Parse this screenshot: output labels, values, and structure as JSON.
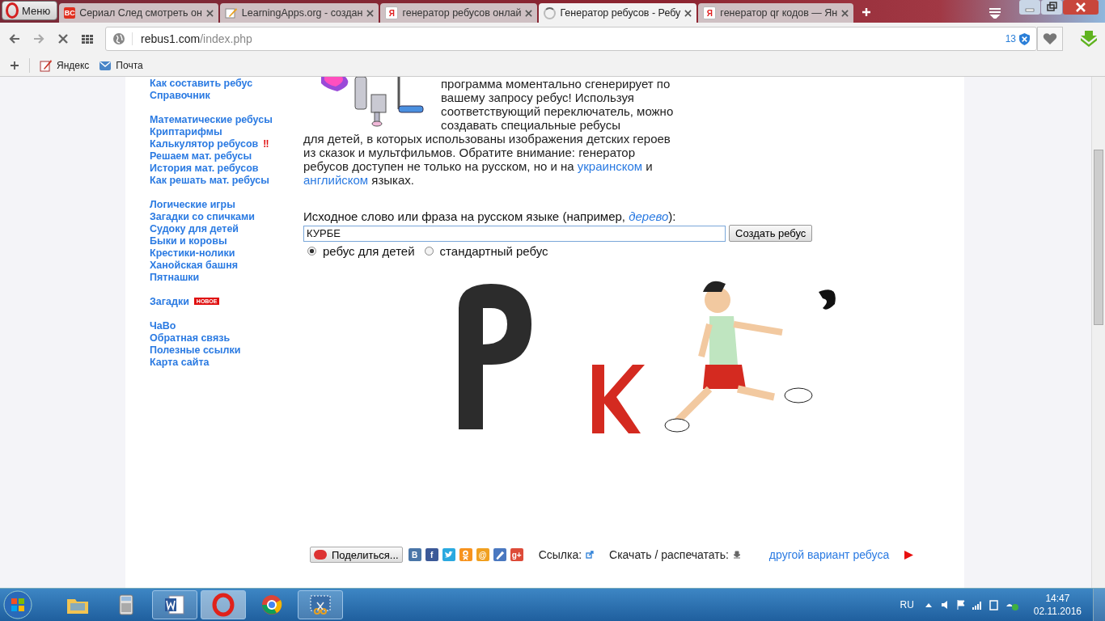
{
  "browser": {
    "menu_label": "Меню",
    "tabs": [
      {
        "title": "Сериал След смотреть он",
        "kind": "bc",
        "favicon_text": "BC",
        "selected": false,
        "loading": false
      },
      {
        "title": "LearningApps.org - создан",
        "kind": "pen",
        "selected": false,
        "loading": false
      },
      {
        "title": "генератор ребусов онлай",
        "kind": "ya",
        "favicon_text": "Я",
        "selected": false,
        "loading": false
      },
      {
        "title": "Генератор ребусов - Ребу",
        "selected": true,
        "loading": true
      },
      {
        "title": "генератор qr кодов — Ян",
        "kind": "ya",
        "favicon_text": "Я",
        "selected": false,
        "loading": false
      }
    ],
    "url_host": "rebus1.com",
    "url_path": "/index.php",
    "blocked_count": "13",
    "bookmarks": [
      {
        "label": "Яндекс",
        "kind": "pen"
      },
      {
        "label": "Почта",
        "kind": "mail"
      }
    ]
  },
  "sidebar": {
    "groups": [
      {
        "items": [
          {
            "label": "Как составить ребус"
          },
          {
            "label": "Справочник"
          }
        ]
      },
      {
        "items": [
          {
            "label": "Математические ребусы"
          },
          {
            "label": "Криптарифмы"
          },
          {
            "label": "Калькулятор ребусов",
            "badge": "‼",
            "kind": "mark"
          },
          {
            "label": "Решаем мат. ребусы"
          },
          {
            "label": "История мат. ребусов"
          },
          {
            "label": "Как решать мат. ребусы"
          }
        ]
      },
      {
        "items": [
          {
            "label": "Логические игры"
          },
          {
            "label": "Загадки со спичками"
          },
          {
            "label": "Судоку для детей"
          },
          {
            "label": "Быки и коровы"
          },
          {
            "label": "Крестики-нолики"
          },
          {
            "label": "Ханойская башня"
          },
          {
            "label": "Пятнашки"
          }
        ]
      },
      {
        "items": [
          {
            "label": "Загадки",
            "badge": "НОВОЕ",
            "kind": "tag"
          }
        ]
      },
      {
        "items": [
          {
            "label": "ЧаВо"
          },
          {
            "label": "Обратная связь"
          },
          {
            "label": "Полезные ссылки"
          },
          {
            "label": "Карта сайта"
          }
        ]
      }
    ]
  },
  "intro": {
    "text_top": "программа моментально сгенерирует по вашему запросу ребус! Используя соответствующий переключатель, можно создавать специальные ребусы",
    "text_before": "для детей, в которых использованы изображения детских героев из сказок и мультфильмов. Обратите внимание: генератор ребусов доступен не только на русском, но и на",
    "link_1": "украинском",
    "text_middle": "и",
    "link_2": "английском",
    "text_after": "языках."
  },
  "form": {
    "label_before": "Исходное слово или фраза на русском языке (например,",
    "example_link": "дерево",
    "label_after": "):",
    "value": "КУРБЕ",
    "submit": "Создать ребус",
    "modes": [
      {
        "label": "ребус для детей",
        "selected": true
      },
      {
        "label": "стандартный ребус",
        "selected": false
      }
    ]
  },
  "footer": {
    "share_label": "Поделиться...",
    "services": [
      {
        "kind": "letter",
        "glyph": "В",
        "color": "#4a76a8"
      },
      {
        "kind": "letter",
        "glyph": "f",
        "color": "#3b5998"
      },
      {
        "kind": "bird",
        "color": "#2aa9e0"
      },
      {
        "kind": "ok",
        "color": "#f7931e"
      },
      {
        "kind": "letter",
        "glyph": "@",
        "color": "#f0a020"
      },
      {
        "kind": "pen",
        "color": "#4a78c0"
      },
      {
        "kind": "letter",
        "glyph": "g+",
        "color": "#dd4b39"
      }
    ],
    "link_label": "Ссылка:",
    "download_label": "Скачать / распечатать:",
    "other_variant": "другой вариант ребуса"
  },
  "taskbar": {
    "apps": [
      {
        "kind": "folder",
        "running": false,
        "selected": false
      },
      {
        "kind": "calculator",
        "running": false,
        "selected": false
      },
      {
        "kind": "word",
        "running": true,
        "selected": false
      },
      {
        "kind": "opera",
        "running": true,
        "selected": true
      },
      {
        "kind": "chrome",
        "running": false,
        "selected": false
      },
      {
        "kind": "snip",
        "running": true,
        "selected": false
      }
    ],
    "language": "RU",
    "time": "14:47",
    "date": "02.11.2016"
  }
}
